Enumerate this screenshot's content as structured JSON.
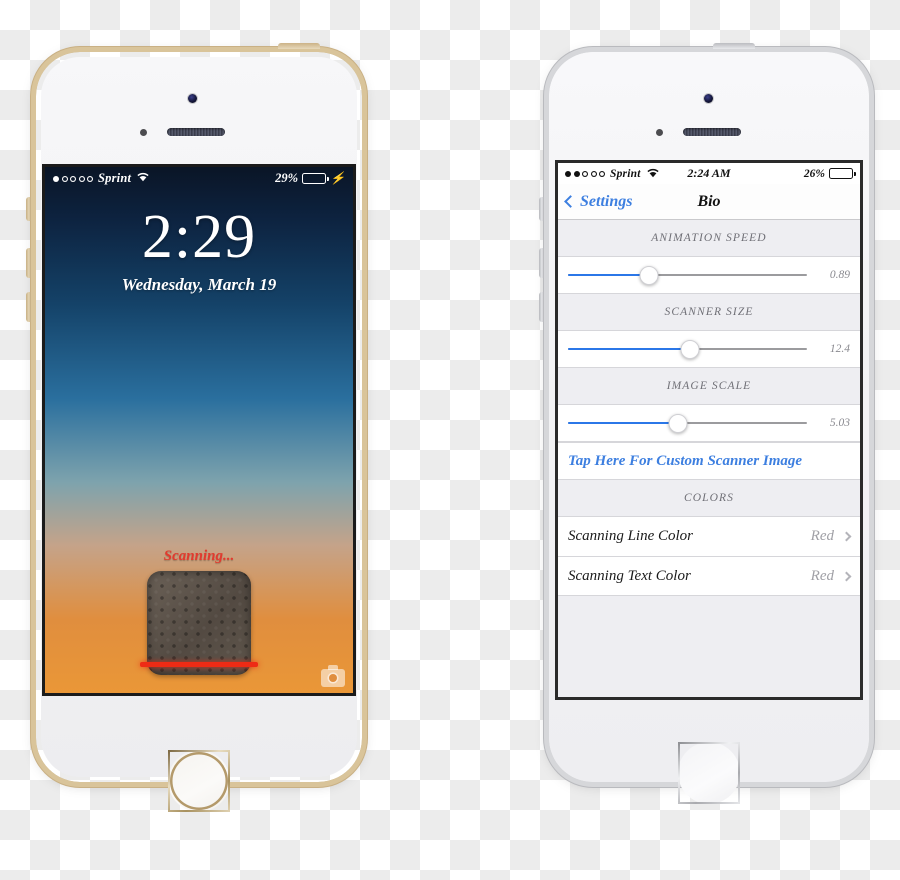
{
  "lock_phone": {
    "bezel_color": "#c9b084",
    "status_bar": {
      "signal_dots": [
        true,
        false,
        false,
        false,
        false
      ],
      "carrier": "Sprint",
      "wifi_icon": "wifi-icon",
      "battery_percent": "29%",
      "battery_level": 29,
      "battery_fill_color": "#5ad65a",
      "charging_icon": "lightning-bolt-icon"
    },
    "clock": {
      "time": "2:29",
      "date": "Wednesday, March 19"
    },
    "scanner": {
      "status_text": "Scanning...",
      "status_text_color": "#e23a2e",
      "line_color": "#ee2b15"
    },
    "camera_shortcut_icon": "camera-icon"
  },
  "settings_phone": {
    "bezel_color": "#b9babe",
    "status_bar": {
      "signal_dots": [
        true,
        true,
        false,
        false,
        false
      ],
      "carrier": "Sprint",
      "wifi_icon": "wifi-icon",
      "time": "2:24 AM",
      "battery_percent": "26%",
      "battery_level": 26
    },
    "navbar": {
      "back_label": "Settings",
      "back_icon": "chevron-left-icon",
      "title": "Bio",
      "accent_color": "#3d7fe0"
    },
    "sections": [
      {
        "header": "ANIMATION SPEED",
        "slider": {
          "value": "0.89",
          "percent": 34,
          "fill_color": "#2b77e8"
        }
      },
      {
        "header": "SCANNER SIZE",
        "slider": {
          "value": "12.4",
          "percent": 51,
          "fill_color": "#2b77e8"
        }
      },
      {
        "header": "IMAGE SCALE",
        "slider": {
          "value": "5.03",
          "percent": 46,
          "fill_color": "#2b77e8"
        }
      }
    ],
    "custom_image_link": "Tap Here For Custom Scanner Image",
    "colors_header": "COLORS",
    "color_rows": [
      {
        "title": "Scanning Line Color",
        "value": "Red",
        "accessory_icon": "chevron-right-icon"
      },
      {
        "title": "Scanning Text Color",
        "value": "Red",
        "accessory_icon": "chevron-right-icon"
      }
    ]
  }
}
